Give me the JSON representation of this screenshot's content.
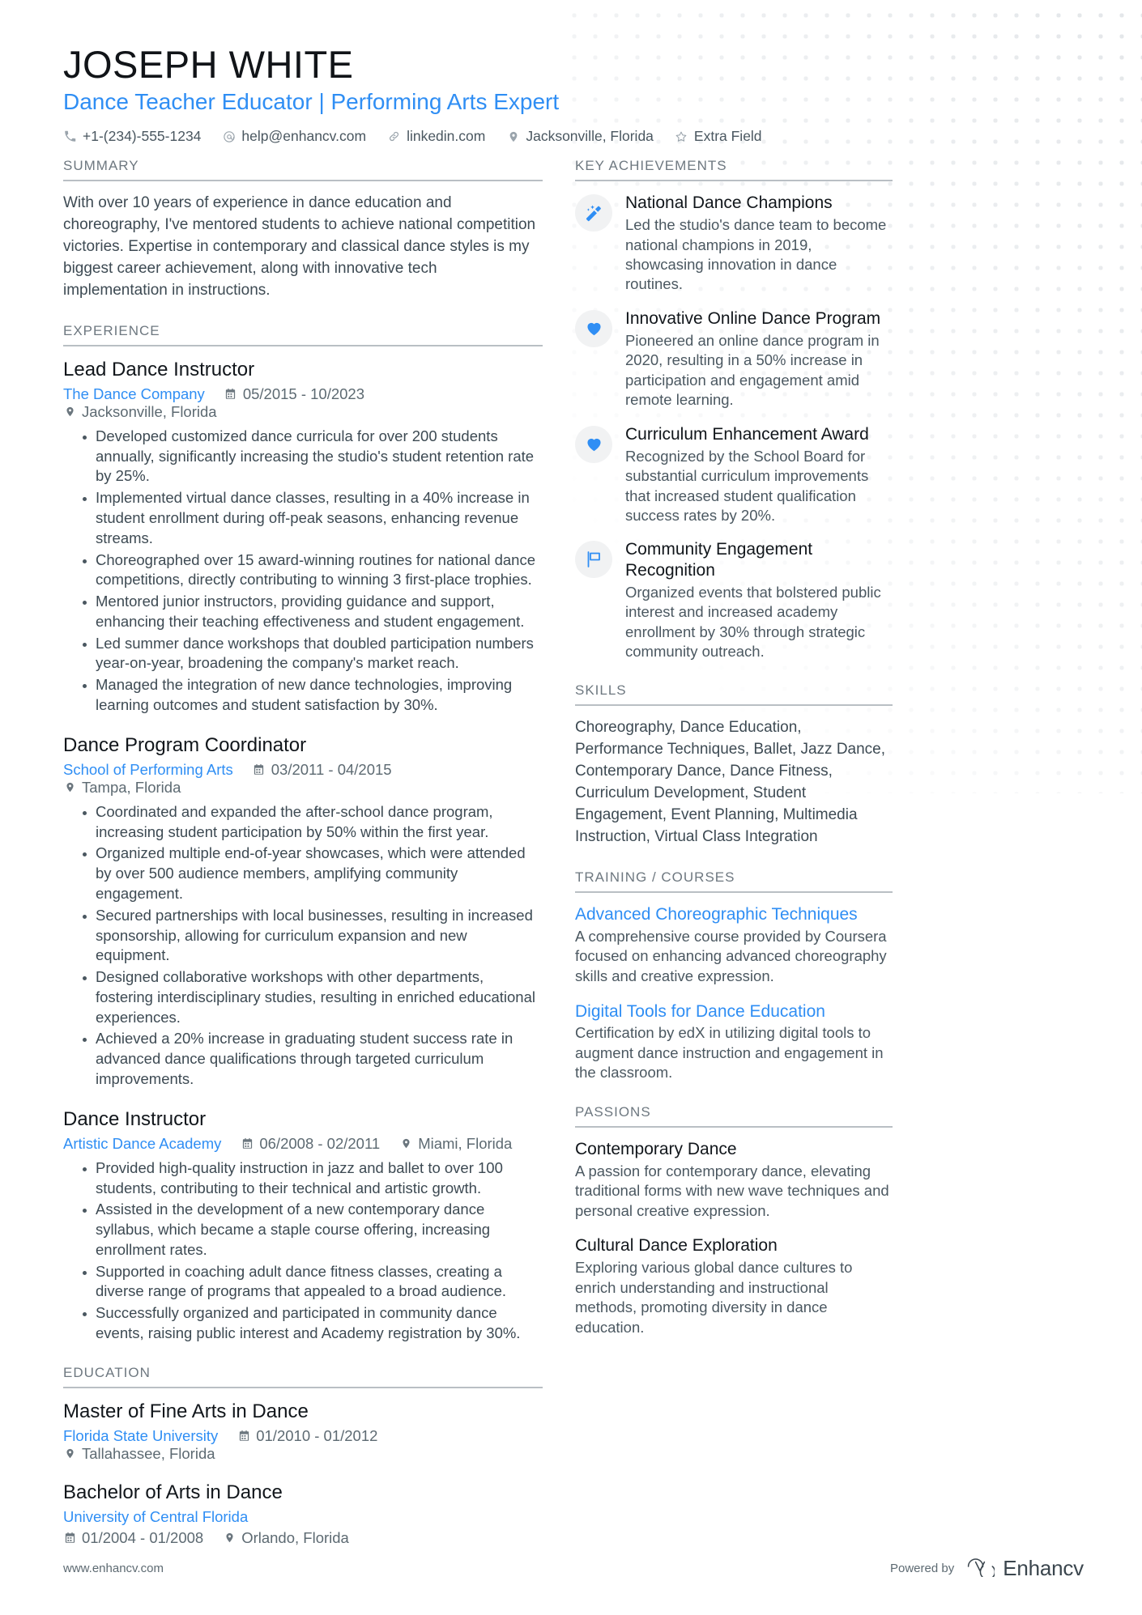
{
  "header": {
    "name": "JOSEPH WHITE",
    "headline": "Dance Teacher Educator | Performing Arts Expert",
    "contacts": [
      {
        "icon": "phone-icon",
        "text": "+1-(234)-555-1234"
      },
      {
        "icon": "email-icon",
        "text": "help@enhancv.com"
      },
      {
        "icon": "link-icon",
        "text": "linkedin.com"
      },
      {
        "icon": "location-pin-icon",
        "text": "Jacksonville, Florida"
      },
      {
        "icon": "star-icon",
        "text": "Extra Field"
      }
    ]
  },
  "left": {
    "summary": {
      "title": "SUMMARY",
      "text": "With over 10 years of experience in dance education and choreography, I've mentored students to achieve national competition victories. Expertise in contemporary and classical dance styles is my biggest career achievement, along with innovative tech implementation in instructions."
    },
    "experience": {
      "title": "EXPERIENCE",
      "entries": [
        {
          "role": "Lead Dance Instructor",
          "org": "The Dance Company",
          "dates": "05/2015 - 10/2023",
          "location": "Jacksonville, Florida",
          "bullets": [
            "Developed customized dance curricula for over 200 students annually, significantly increasing the studio's student retention rate by 25%.",
            "Implemented virtual dance classes, resulting in a 40% increase in student enrollment during off-peak seasons, enhancing revenue streams.",
            "Choreographed over 15 award-winning routines for national dance competitions, directly contributing to winning 3 first-place trophies.",
            "Mentored junior instructors, providing guidance and support, enhancing their teaching effectiveness and student engagement.",
            "Led summer dance workshops that doubled participation numbers year-on-year, broadening the company's market reach.",
            "Managed the integration of new dance technologies, improving learning outcomes and student satisfaction by 30%."
          ]
        },
        {
          "role": "Dance Program Coordinator",
          "org": "School of Performing Arts",
          "dates": "03/2011 - 04/2015",
          "location": "Tampa, Florida",
          "bullets": [
            "Coordinated and expanded the after-school dance program, increasing student participation by 50% within the first year.",
            "Organized multiple end-of-year showcases, which were attended by over 500 audience members, amplifying community engagement.",
            "Secured partnerships with local businesses, resulting in increased sponsorship, allowing for curriculum expansion and new equipment.",
            "Designed collaborative workshops with other departments, fostering interdisciplinary studies, resulting in enriched educational experiences.",
            "Achieved a 20% increase in graduating student success rate in advanced dance qualifications through targeted curriculum improvements."
          ]
        },
        {
          "role": "Dance Instructor",
          "org": "Artistic Dance Academy",
          "dates": "06/2008 - 02/2011",
          "location": "Miami, Florida",
          "bullets": [
            "Provided high-quality instruction in jazz and ballet to over 100 students, contributing to their technical and artistic growth.",
            "Assisted in the development of a new contemporary dance syllabus, which became a staple course offering, increasing enrollment rates.",
            "Supported in coaching adult dance fitness classes, creating a diverse range of programs that appealed to a broad audience.",
            "Successfully organized and participated in community dance events, raising public interest and Academy registration by 30%."
          ]
        }
      ]
    },
    "education": {
      "title": "EDUCATION",
      "entries": [
        {
          "degree": "Master of Fine Arts in Dance",
          "school": "Florida State University",
          "dates": "01/2010 - 01/2012",
          "location": "Tallahassee, Florida",
          "wrap": false
        },
        {
          "degree": "Bachelor of Arts in Dance",
          "school": "University of Central Florida",
          "dates": "01/2004 - 01/2008",
          "location": "Orlando, Florida",
          "wrap": true
        }
      ]
    }
  },
  "right": {
    "achievements": {
      "title": "KEY ACHIEVEMENTS",
      "items": [
        {
          "icon": "magic-wand-icon",
          "title": "National Dance Champions",
          "desc": "Led the studio's dance team to become national champions in 2019, showcasing innovation in dance routines."
        },
        {
          "icon": "heart-icon",
          "title": "Innovative Online Dance Program",
          "desc": "Pioneered an online dance program in 2020, resulting in a 50% increase in participation and engagement amid remote learning."
        },
        {
          "icon": "heart-icon",
          "title": "Curriculum Enhancement Award",
          "desc": "Recognized by the School Board for substantial curriculum improvements that increased student qualification success rates by 20%."
        },
        {
          "icon": "flag-icon",
          "title": "Community Engagement Recognition",
          "desc": "Organized events that bolstered public interest and increased academy enrollment by 30% through strategic community outreach."
        }
      ]
    },
    "skills": {
      "title": "SKILLS",
      "text": "Choreography, Dance Education, Performance Techniques, Ballet, Jazz Dance, Contemporary Dance, Dance Fitness, Curriculum Development, Student Engagement, Event Planning, Multimedia Instruction, Virtual Class Integration"
    },
    "training": {
      "title": "TRAINING / COURSES",
      "items": [
        {
          "name": "Advanced Choreographic Techniques",
          "desc": "A comprehensive course provided by Coursera focused on enhancing advanced choreography skills and creative expression."
        },
        {
          "name": "Digital Tools for Dance Education",
          "desc": "Certification by edX in utilizing digital tools to augment dance instruction and engagement in the classroom."
        }
      ]
    },
    "passions": {
      "title": "PASSIONS",
      "items": [
        {
          "name": "Contemporary Dance",
          "desc": "A passion for contemporary dance, elevating traditional forms with new wave techniques and personal creative expression."
        },
        {
          "name": "Cultural Dance Exploration",
          "desc": "Exploring various global dance cultures to enrich understanding and instructional methods, promoting diversity in dance education."
        }
      ]
    }
  },
  "footer": {
    "url": "www.enhancv.com",
    "powered_by": "Powered by",
    "brand": "Enhancv"
  },
  "colors": {
    "accent": "#2f8ef4",
    "text": "#3d4a53",
    "heading": "#11161b",
    "muted": "#6e7880",
    "badge_bg": "#f1f2f3"
  }
}
